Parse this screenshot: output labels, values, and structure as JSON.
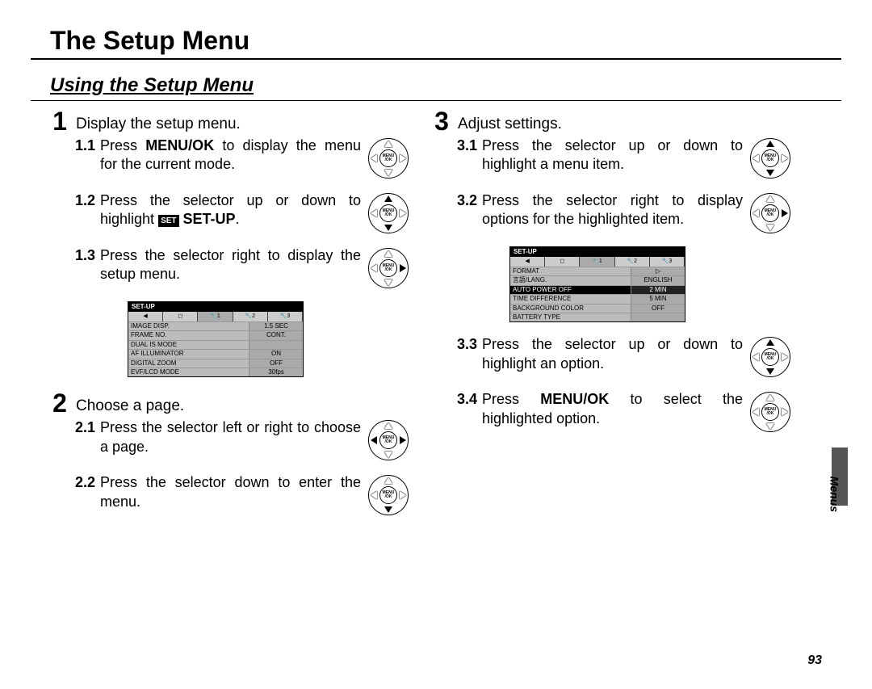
{
  "title": "The Setup Menu",
  "subtitle": "Using the Setup Menu",
  "side_section": "Menus",
  "page_number": "93",
  "selector_center": "MENU\n/OK",
  "steps": [
    {
      "num": "1",
      "head": "Display the setup menu.",
      "subs": [
        {
          "n": "1.1",
          "pre": "Press ",
          "bold": "MENU/OK",
          "post": " to display the menu for the current mode.",
          "icon": "center"
        },
        {
          "n": "1.2",
          "pre": "Press the selector up or down to highlight ",
          "bold": "SET-UP",
          "post": ".",
          "badge": "SET",
          "icon": "updown"
        },
        {
          "n": "1.3",
          "pre": "Press the selector right to display the setup menu.",
          "bold": "",
          "post": "",
          "icon": "right"
        }
      ]
    },
    {
      "num": "2",
      "head": "Choose a page.",
      "subs": [
        {
          "n": "2.1",
          "pre": "Press the selector left or right to choose a page.",
          "bold": "",
          "post": "",
          "icon": "leftright"
        },
        {
          "n": "2.2",
          "pre": "Press the selector down to enter the menu.",
          "bold": "",
          "post": "",
          "icon": "down"
        }
      ]
    },
    {
      "num": "3",
      "head": "Adjust settings.",
      "subs": [
        {
          "n": "3.1",
          "pre": "Press the selector up or down to highlight a menu item.",
          "bold": "",
          "post": "",
          "icon": "updown"
        },
        {
          "n": "3.2",
          "pre": "Press the selector right to display options for the highlighted item.",
          "bold": "",
          "post": "",
          "icon": "right"
        },
        {
          "n": "3.3",
          "pre": "Press the selector up or down to highlight an option.",
          "bold": "",
          "post": "",
          "icon": "updown"
        },
        {
          "n": "3.4",
          "pre": "Press ",
          "bold": "MENU/OK",
          "post": " to select the highlighted option.",
          "icon": "center"
        }
      ]
    }
  ],
  "menu_screen_1": {
    "title": "SET-UP",
    "tabs": [
      "◀",
      "◻",
      "🔧1",
      "🔧2",
      "🔧3"
    ],
    "active_tab": 2,
    "rows": [
      {
        "k": "IMAGE DISP.",
        "v": "1.5 SEC"
      },
      {
        "k": "FRAME NO.",
        "v": "CONT."
      },
      {
        "k": "DUAL IS MODE",
        "v": ""
      },
      {
        "k": "AF ILLUMINATOR",
        "v": "ON"
      },
      {
        "k": "DIGITAL ZOOM",
        "v": "OFF"
      },
      {
        "k": "EVF/LCD MODE",
        "v": "30fps"
      }
    ],
    "active_row": -1
  },
  "menu_screen_2": {
    "title": "SET-UP",
    "tabs": [
      "◀",
      "◻",
      "🔧1",
      "🔧2",
      "🔧3"
    ],
    "active_tab": 2,
    "rows": [
      {
        "k": "FORMAT",
        "v": "▷"
      },
      {
        "k": "言語/LANG.",
        "v": "ENGLISH"
      },
      {
        "k": "AUTO POWER OFF",
        "v": "2 MIN"
      },
      {
        "k": "TIME DIFFERENCE",
        "v": "5 MIN"
      },
      {
        "k": "BACKGROUND COLOR",
        "v": "OFF"
      },
      {
        "k": "BATTERY TYPE",
        "v": ""
      }
    ],
    "active_row": 2
  }
}
